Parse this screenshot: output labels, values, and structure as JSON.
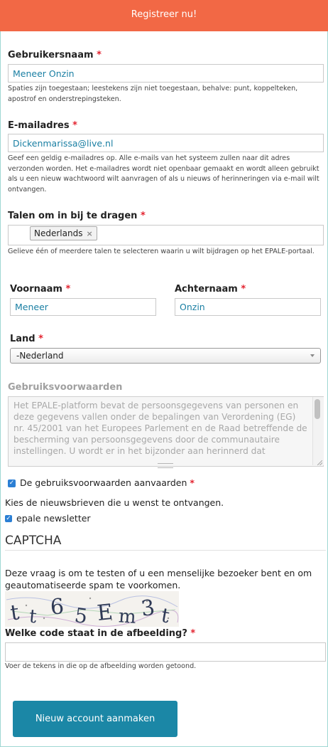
{
  "header": {
    "title": "Registreer nu!"
  },
  "username": {
    "label": "Gebruikersnaam",
    "required_mark": "*",
    "value": "Meneer Onzin",
    "help": "Spaties zijn toegestaan; leestekens zijn niet toegestaan, behalve: punt, koppelteken, apostrof en onderstrepingsteken."
  },
  "email": {
    "label": "E-mailadres",
    "required_mark": "*",
    "value": "Dickenmarissa@live.nl",
    "help": "Geef een geldig e-mailadres op. Alle e-mails van het systeem zullen naar dit adres verzonden worden. Het e-mailadres wordt niet openbaar gemaakt en wordt alleen gebruikt als u een nieuw wachtwoord wilt aanvragen of als u nieuws of herinneringen via e-mail wilt ontvangen."
  },
  "languages": {
    "label": "Talen om in bij te dragen",
    "required_mark": "*",
    "selected": [
      "Nederlands"
    ],
    "remove_symbol": "×",
    "help": "Gelieve één of meerdere talen te selecteren waarin u wilt bijdragen op het EPALE-portaal."
  },
  "firstname": {
    "label": "Voornaam",
    "required_mark": "*",
    "value": "Meneer"
  },
  "lastname": {
    "label": "Achternaam",
    "required_mark": "*",
    "value": "Onzin"
  },
  "country": {
    "label": "Land",
    "required_mark": "*",
    "selected": "-Nederland"
  },
  "terms": {
    "label": "Gebruiksvoorwaarden",
    "text": "Het EPALE-platform bevat de persoonsgegevens van personen en deze gegevens vallen onder de bepalingen van Verordening (EG) nr. 45/2001 van het Europees Parlement en de Raad betreffende de bescherming van persoonsgegevens door de communautaire instellingen. U wordt er in het bijzonder aan herinnerd dat",
    "accept_label": "De gebruiksvoorwaarden aanvaarden",
    "accept_required_mark": "*",
    "accept_checked": true
  },
  "newsletter": {
    "intro": "Kies de nieuwsbrieven die u wenst te ontvangen.",
    "option_label": "epale newsletter",
    "option_checked": true
  },
  "captcha": {
    "title": "CAPTCHA",
    "description": "Deze vraag is om te testen of u een menselijke bezoeker bent en om geautomatiseerde spam te voorkomen.",
    "image_chars": [
      "t",
      "t",
      "6",
      "5",
      "E",
      "m",
      "3",
      "t"
    ],
    "question_label": "Welke code staat in de afbeelding?",
    "question_required_mark": "*",
    "answer_value": "",
    "help": "Voer de tekens in die op de afbeelding worden getoond."
  },
  "submit": {
    "label": "Nieuw account aanmaken"
  },
  "colors": {
    "header": "#f26845",
    "button": "#1b87a6",
    "required": "#e3232f",
    "input_text": "#1a7fa3",
    "checkbox": "#2b7fd4"
  }
}
